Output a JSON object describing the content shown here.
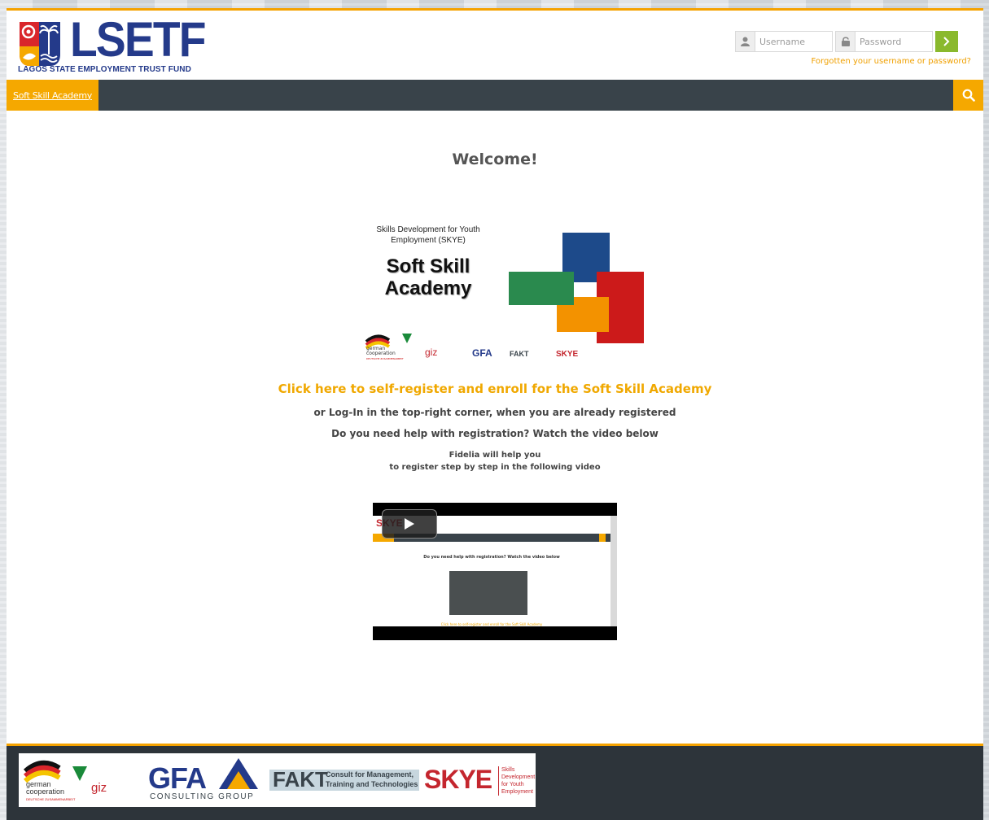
{
  "header": {
    "logo_text": "LSETF",
    "logo_subtitle_a": "LAGOS STATE ",
    "logo_subtitle_b": "EMPLOYMENT",
    "logo_subtitle_c": " TRUST FUND",
    "username_placeholder": "Username",
    "password_placeholder": "Password",
    "forgot_link": "Forgotten your username or password?"
  },
  "nav": {
    "items": [
      {
        "label": "Soft Skill Academy"
      }
    ]
  },
  "main": {
    "title": "Welcome!",
    "banner": {
      "program_line": "Skills Development for Youth Employment (SKYE)",
      "academy_title_1": "Soft Skill",
      "academy_title_2": "Academy",
      "partner_german": "german",
      "partner_cooperation": "cooperation",
      "partner_deutsche": "DEUTSCHE ZUSAMMENARBEIT",
      "partner_giz": "giz",
      "partner_gfa": "GFA",
      "partner_fakt": "FAKT",
      "partner_skye": "SKYE"
    },
    "cta_link": "Click here to self-register and enroll for the Soft Skill Academy",
    "login_hint": "or Log-In in the top-right corner, when you are already registered",
    "help_question": "Do you need help with registration? Watch the video below",
    "fidelia_line1": "Fidelia will help you",
    "fidelia_line2": "to register step by step in the following video",
    "video": {
      "thumb_logo": "SKYE",
      "thumb_text": "Do you need help with registration? Watch the video below",
      "thumb_link": "Click here to self-register and enroll for the Soft Skill Academy"
    }
  },
  "footer": {
    "german": "german",
    "cooperation": "cooperation",
    "deutsche": "DEUTSCHE ZUSAMMENARBEIT",
    "giz": "giz",
    "gfa": "GFA",
    "gfa_sub": "CONSULTING GROUP",
    "fakt": "FAKT",
    "fakt_sub_1": "Consult for Management,",
    "fakt_sub_2": "Training and Technologies",
    "skye": "SKYE",
    "skye_sub_1": "Skills",
    "skye_sub_2": "Development",
    "skye_sub_3": "for Youth",
    "skye_sub_4": "Employment"
  },
  "colors": {
    "accent": "#f5a800",
    "navbar": "#39434a",
    "footer": "#2d343a",
    "brand_blue": "#243a8a",
    "login_button": "#8ab92d",
    "square_blue": "#1d4a8a",
    "square_green": "#2a8a4e",
    "square_red": "#cc1a1a",
    "square_orange": "#f39200"
  }
}
